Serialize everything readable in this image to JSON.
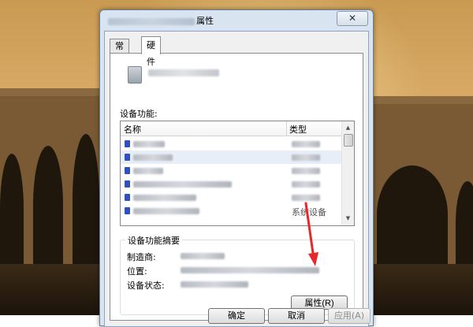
{
  "window": {
    "title_suffix": "属性",
    "close_symbol": "✕"
  },
  "tabs": [
    {
      "label": "常规",
      "active": false
    },
    {
      "label": "硬件",
      "active": true
    }
  ],
  "hardware": {
    "functions_label": "设备功能:",
    "columns": {
      "name": "名称",
      "type": "类型"
    },
    "visible_type_fragment": "系统设备",
    "summary": {
      "title": "设备功能摘要",
      "manufacturer_label": "制造商:",
      "location_label": "位置:",
      "status_label": "设备状态:",
      "properties_button": "属性(R)"
    }
  },
  "buttons": {
    "ok": "确定",
    "cancel": "取消",
    "apply": "应用(A)"
  },
  "colors": {
    "annotation_arrow": "#e8282a",
    "device_row_icon": "#2f4fc7"
  }
}
